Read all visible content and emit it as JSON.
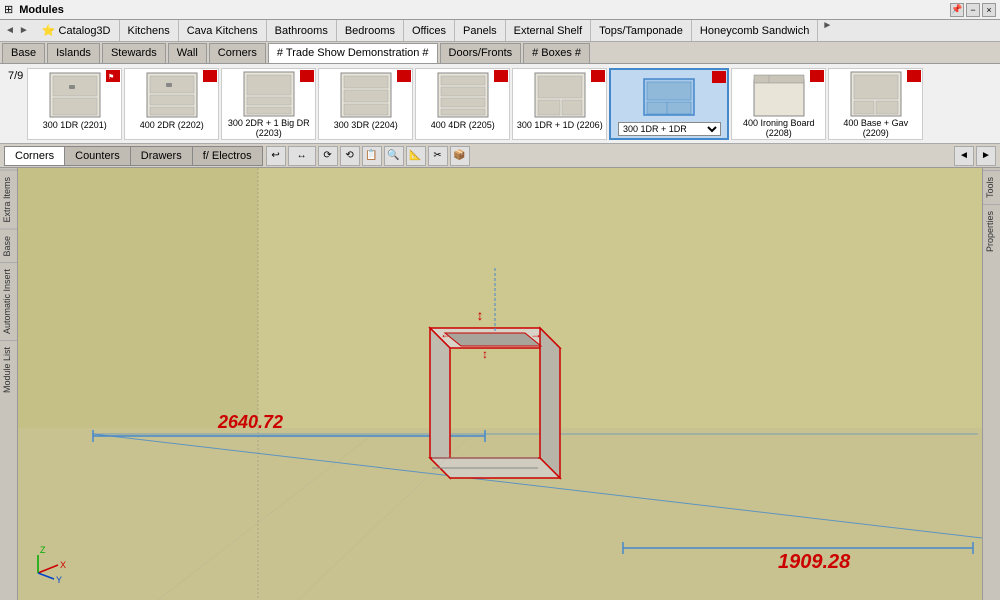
{
  "titleBar": {
    "title": "Modules",
    "winControls": [
      "−",
      "□",
      "×"
    ]
  },
  "topTabs": {
    "navLeft": "◄",
    "navRight": "►",
    "tabs": [
      {
        "label": "Catalog3D",
        "icon": "📦",
        "active": false
      },
      {
        "label": "Kitchens",
        "active": false
      },
      {
        "label": "Cava Kitchens",
        "active": false
      },
      {
        "label": "Bathrooms",
        "active": false
      },
      {
        "label": "Bedrooms",
        "active": false
      },
      {
        "label": "Offices",
        "active": false
      },
      {
        "label": "Panels",
        "active": false
      },
      {
        "label": "External Shelf",
        "active": false
      },
      {
        "label": "Tops/Tamponade",
        "active": false
      },
      {
        "label": "Honeycomb Sandwich",
        "active": false
      }
    ],
    "moreBtn": "►"
  },
  "catTabs": {
    "tabs": [
      {
        "label": "Base",
        "active": false
      },
      {
        "label": "Islands",
        "active": false
      },
      {
        "label": "Stewards",
        "active": false
      },
      {
        "label": "Wall",
        "active": false
      },
      {
        "label": "Corners",
        "active": false
      },
      {
        "label": "# Trade Show Demonstration #",
        "active": true,
        "hash": true
      },
      {
        "label": "Doors/Fronts",
        "active": false
      },
      {
        "label": "# Boxes #",
        "active": false,
        "hash": true
      }
    ]
  },
  "itemStrip": {
    "count": "7/9",
    "items": [
      {
        "label": "300 1DR (2201)",
        "selected": false
      },
      {
        "label": "400 2DR (2202)",
        "selected": false
      },
      {
        "label": "300 2DR + 1 Big DR (2203)",
        "selected": false
      },
      {
        "label": "300 3DR (2204)",
        "selected": false
      },
      {
        "label": "400 4DR (2205)",
        "selected": false
      },
      {
        "label": "300 1DR + 1D (2206)",
        "selected": false
      },
      {
        "label": "300 1DR + 1DR",
        "selected": true,
        "dropdown": true
      },
      {
        "label": "400 Ironing Board (2208)",
        "selected": false
      },
      {
        "label": "400 Base + Gav (2209)",
        "selected": false
      }
    ]
  },
  "subTabs": {
    "tabs": [
      {
        "label": "Corners",
        "active": true
      },
      {
        "label": "Counters",
        "active": false
      },
      {
        "label": "Drawers",
        "active": false
      },
      {
        "label": "f/ Electros",
        "active": false
      }
    ],
    "tools": [
      "↩",
      "↔",
      "⟳",
      "⟲",
      "📋",
      "🔍",
      "📐",
      "✂",
      "📦"
    ]
  },
  "measurements": {
    "left": "2640.72",
    "right": "1909.28"
  },
  "leftSidebar": {
    "items": [
      "Extra Items",
      "Base",
      "Automatic Insert",
      "Module List"
    ]
  },
  "rightSidebar": {
    "items": [
      "Tools",
      "Properties"
    ]
  },
  "viewport": {
    "bgColor": "#d2cc9e"
  }
}
